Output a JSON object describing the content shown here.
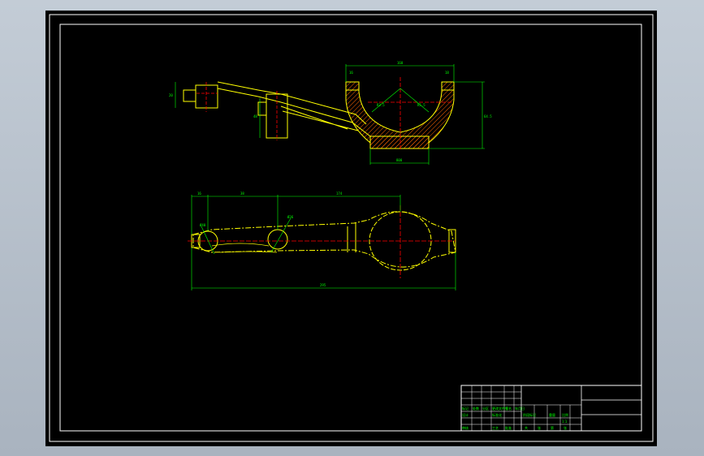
{
  "colors": {
    "frame": "#ffffff",
    "part_outline": "#ffff00",
    "dimension": "#00ff00",
    "centerline": "#ff0000",
    "hatch": "#ff6600",
    "background": "#000000"
  },
  "front_view": {
    "dim_top_width": "160",
    "dim_left_wall": "16",
    "dim_right_wall": "18",
    "dim_radius_left": "R3.5",
    "dim_radius_right": "R5.5",
    "dim_height": "64.5",
    "dim_bottom": "800",
    "dim_block_left": "20",
    "dim_block_mid": "48"
  },
  "top_view": {
    "dim_a": "16",
    "dim_b": "38",
    "dim_c": "174",
    "dim_overall": "295",
    "dim_circle_left": "Ø40",
    "dim_circle_mid": "Ø36"
  },
  "title_block": {
    "row_labels": [
      "标记",
      "处数",
      "分区",
      "更改文件号",
      "签名",
      "年月日"
    ],
    "design": "设计",
    "standardize": "标准化",
    "stage_marks": "阶段标记",
    "weight": "重量",
    "scale": "比例",
    "scale_value": "1:1",
    "review": "审核",
    "process": "工艺",
    "approve": "批准",
    "sheet_total": "共",
    "sheet_no": "第",
    "sheet_unit": "张"
  }
}
